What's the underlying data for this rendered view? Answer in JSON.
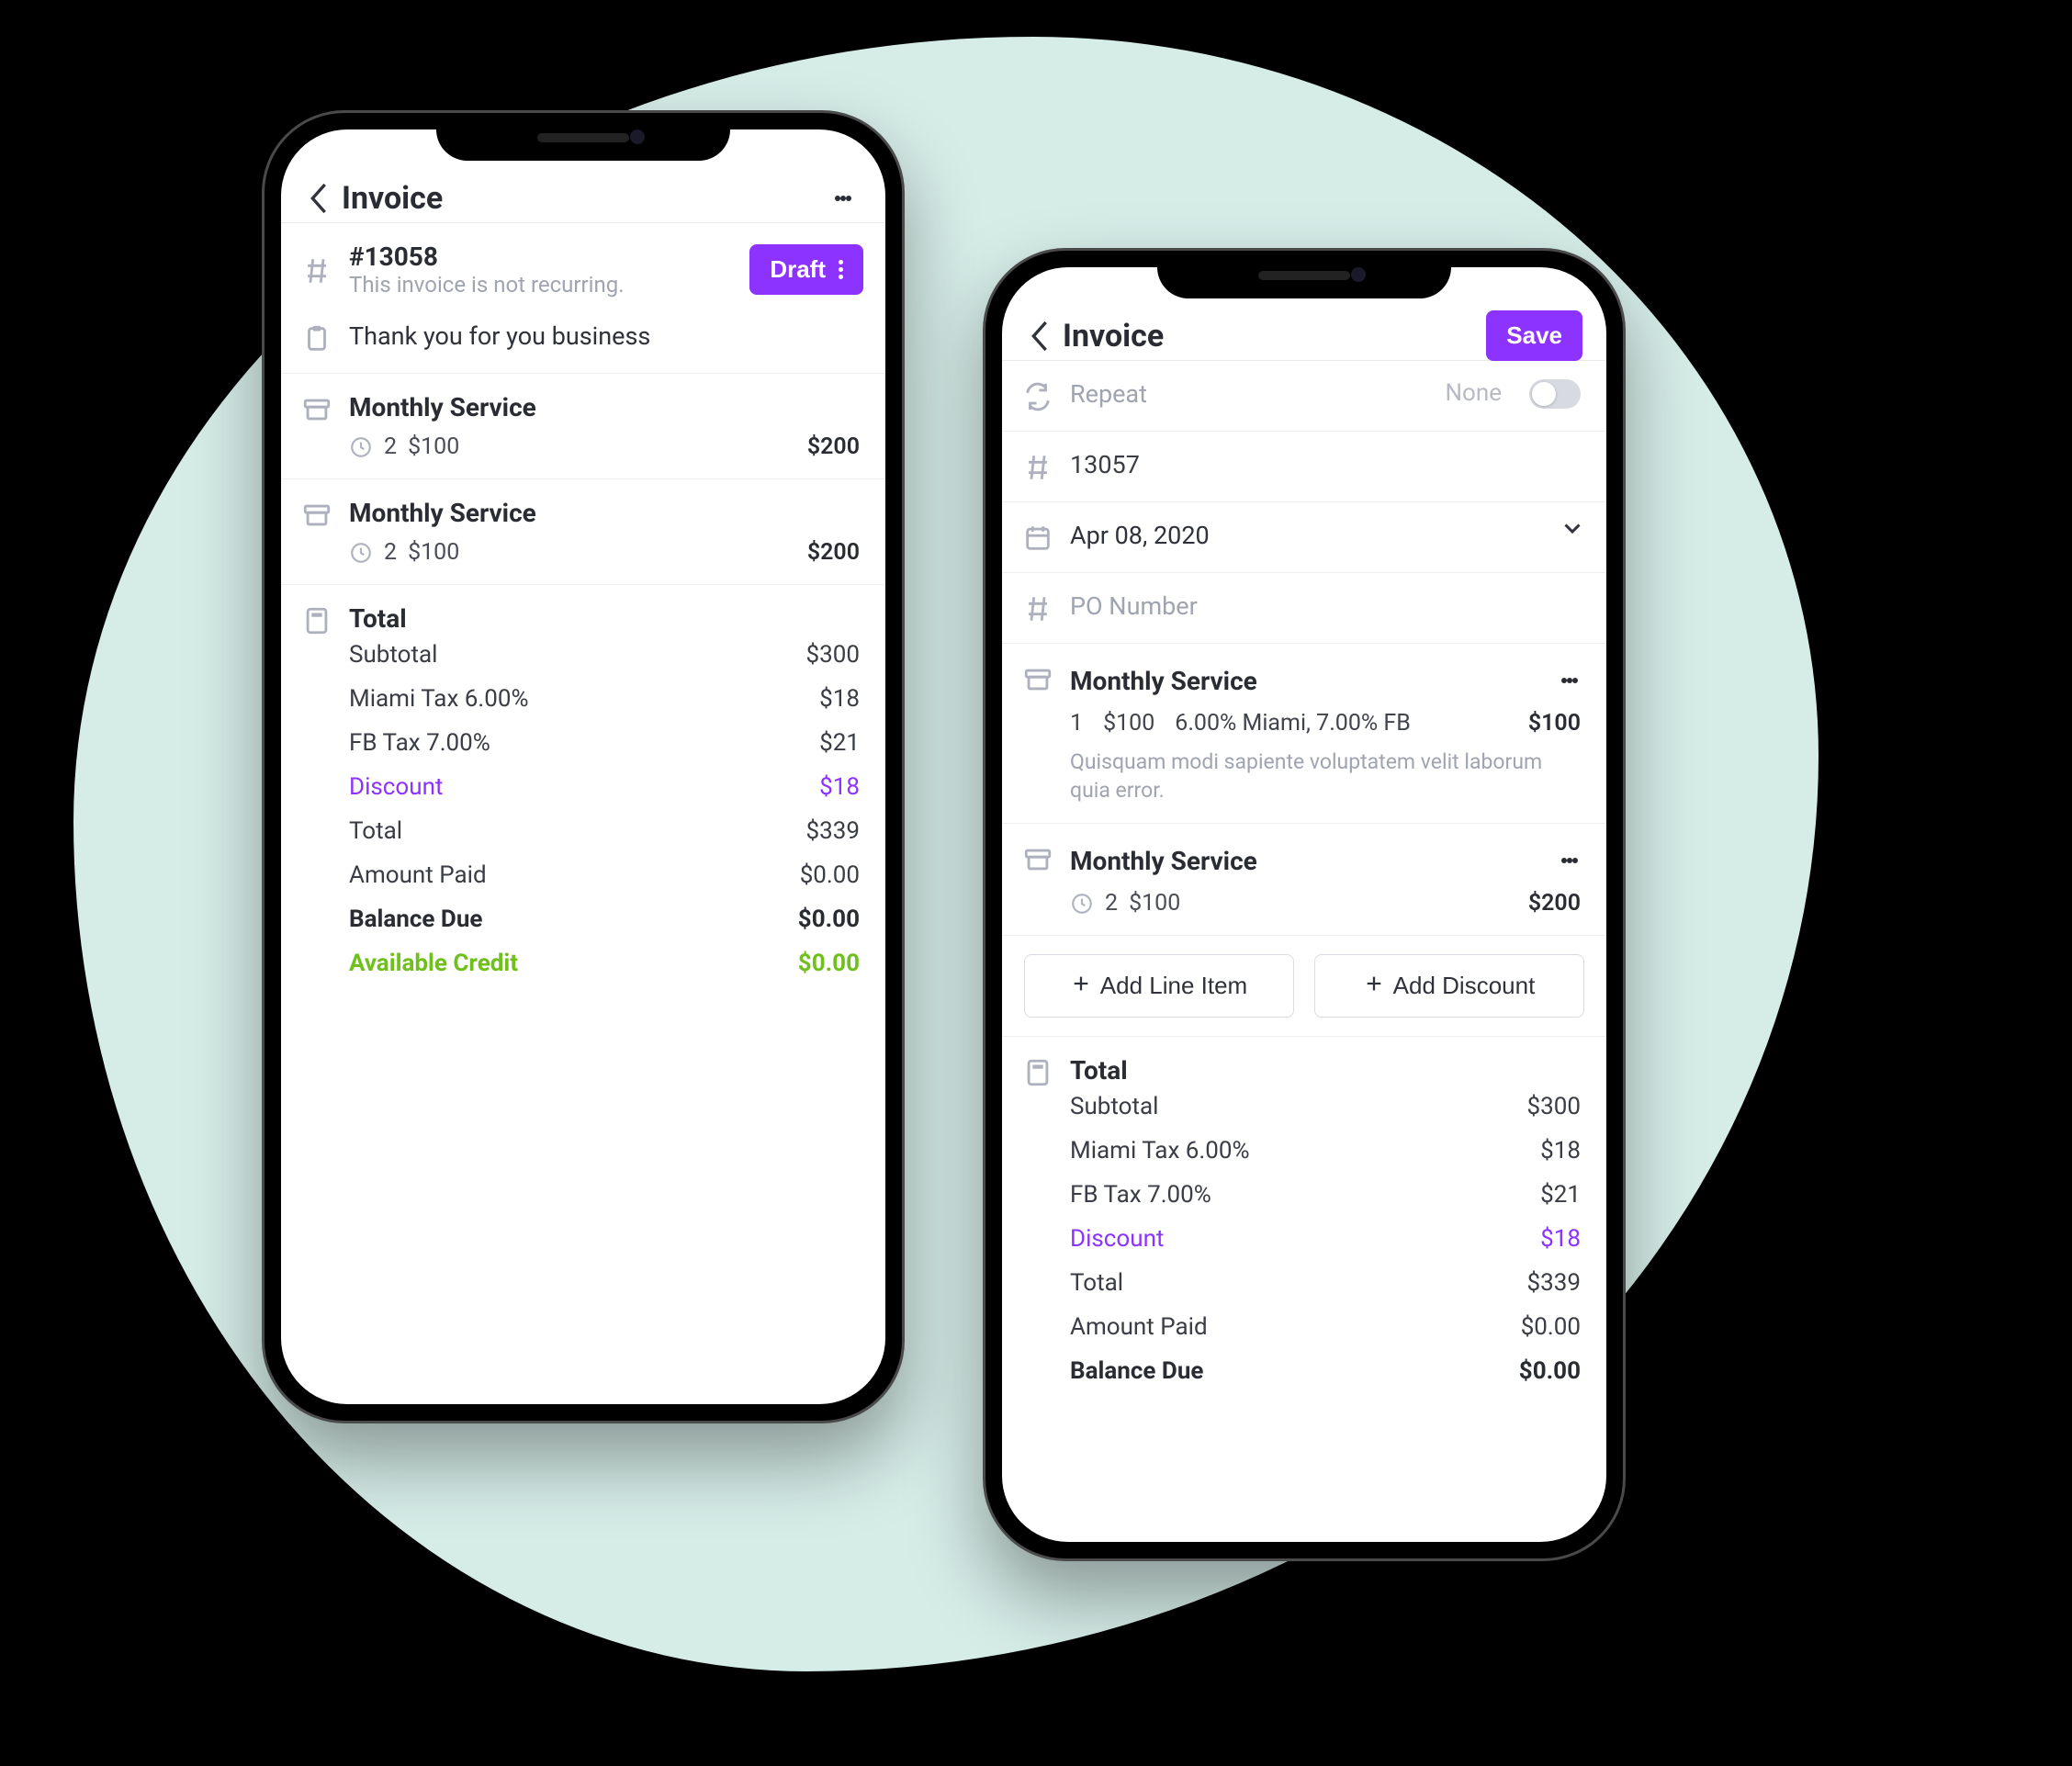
{
  "left": {
    "title": "Invoice",
    "status": {
      "id": "#13058",
      "note": "This invoice is not recurring.",
      "badge": "Draft"
    },
    "note": "Thank you for you business",
    "items": [
      {
        "name": "Monthly Service",
        "qty": "2",
        "price": "$100",
        "amount": "$200"
      },
      {
        "name": "Monthly Service",
        "qty": "2",
        "price": "$100",
        "amount": "$200"
      }
    ],
    "totals": {
      "title": "Total",
      "subtotal_l": "Subtotal",
      "subtotal_v": "$300",
      "tax1_l": "Miami Tax 6.00%",
      "tax1_v": "$18",
      "tax2_l": "FB Tax 7.00%",
      "tax2_v": "$21",
      "discount_l": "Discount",
      "discount_v": "$18",
      "total_l": "Total",
      "total_v": "$339",
      "paid_l": "Amount Paid",
      "paid_v": "$0.00",
      "balance_l": "Balance Due",
      "balance_v": "$0.00",
      "credit_l": "Available Credit",
      "credit_v": "$0.00"
    }
  },
  "right": {
    "title": "Invoice",
    "save": "Save",
    "repeat_l": "Repeat",
    "repeat_v": "None",
    "id": "13057",
    "date": "Apr 08, 2020",
    "po": "PO Number",
    "items": [
      {
        "name": "Monthly Service",
        "qty": "1",
        "price": "$100",
        "tax": "6.00% Miami, 7.00% FB",
        "amount": "$100",
        "desc": "Quisquam modi sapiente voluptatem velit laborum quia error."
      },
      {
        "name": "Monthly Service",
        "qty": "2",
        "price": "$100",
        "amount": "$200"
      }
    ],
    "add_item": "Add Line Item",
    "add_discount": "Add Discount",
    "totals": {
      "title": "Total",
      "subtotal_l": "Subtotal",
      "subtotal_v": "$300",
      "tax1_l": "Miami Tax 6.00%",
      "tax1_v": "$18",
      "tax2_l": "FB Tax 7.00%",
      "tax2_v": "$21",
      "discount_l": "Discount",
      "discount_v": "$18",
      "total_l": "Total",
      "total_v": "$339",
      "paid_l": "Amount Paid",
      "paid_v": "$0.00",
      "balance_l": "Balance Due",
      "balance_v": "$0.00"
    }
  }
}
